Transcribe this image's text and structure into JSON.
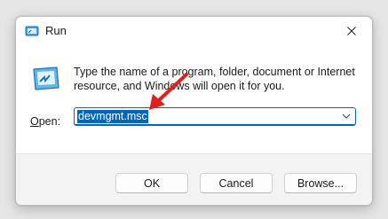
{
  "window": {
    "title": "Run",
    "close_icon": "close-icon",
    "app_icon": "run-icon"
  },
  "content": {
    "description": "Type the name of a program, folder, document or Internet resource, and Windows will open it for you.",
    "open_label_underlined": "O",
    "open_label_rest": "pen:",
    "open_value": "devmgmt.msc",
    "dropdown_icon": "chevron-down-icon",
    "annotation_icon": "red-arrow-icon"
  },
  "buttons": {
    "ok": "OK",
    "cancel": "Cancel",
    "browse": "Browse..."
  },
  "colors": {
    "accent": "#0067c0",
    "annotation": "#e0201b",
    "footer_bg": "#f3f3f3"
  }
}
